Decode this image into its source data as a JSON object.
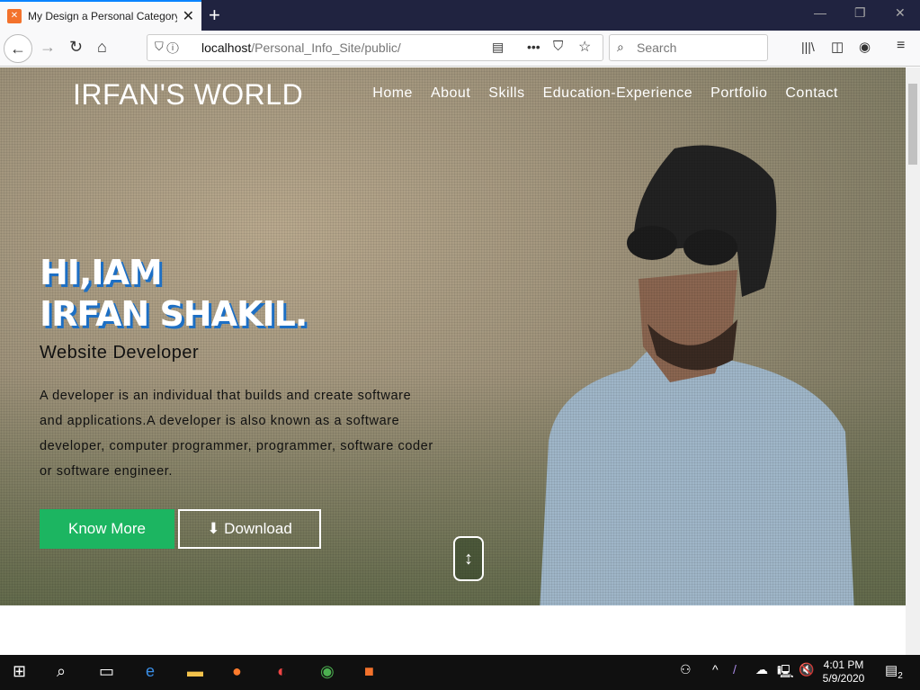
{
  "browser": {
    "tab_title": "My Design a Personal Category",
    "url_host": "localhost",
    "url_path": "/Personal_Info_Site/public/",
    "search_placeholder": "Search"
  },
  "site": {
    "brand": "IRFAN'S WORLD",
    "nav": [
      "Home",
      "About",
      "Skills",
      "Education-Experience",
      "Portfolio",
      "Contact"
    ],
    "heading_line1": "HI,IAM",
    "heading_line2": "IRFAN SHAKIL.",
    "subtitle": "Website Developer",
    "description": "A developer is an individual that builds and create software and applications.A developer is also known as a software developer, computer programmer, programmer, software coder or software engineer.",
    "know_more": "Know More",
    "download": "Download",
    "accent": "#1cb561",
    "heading_shadow": "#1d6fc4"
  },
  "taskbar": {
    "time": "4:01 PM",
    "date": "5/9/2020",
    "notifications": "2"
  }
}
